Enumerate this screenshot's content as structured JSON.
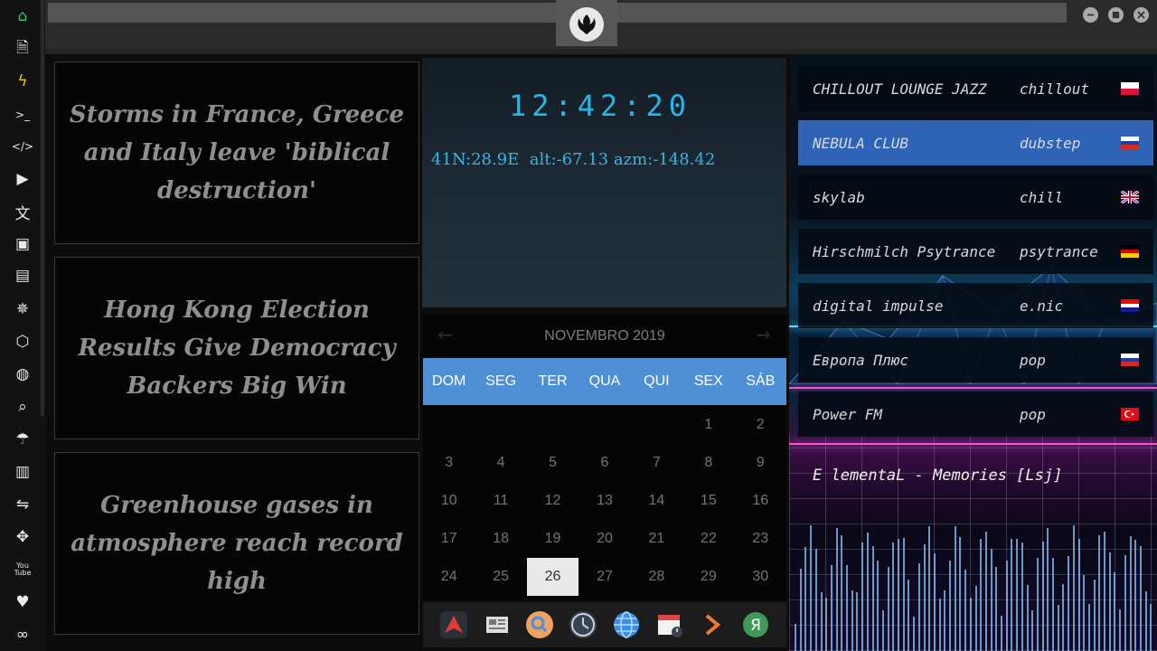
{
  "sidebar": {
    "items": [
      {
        "icon": "home-icon",
        "glyph": "⌂"
      },
      {
        "icon": "document-icon",
        "glyph": "🗎"
      },
      {
        "icon": "lightning-icon",
        "glyph": "ϟ"
      },
      {
        "icon": "terminal-icon",
        "glyph": ">_"
      },
      {
        "icon": "code-icon",
        "glyph": "</>"
      },
      {
        "icon": "play-icon",
        "glyph": "▶"
      },
      {
        "icon": "translate-icon",
        "glyph": "文"
      },
      {
        "icon": "image-icon",
        "glyph": "▣"
      },
      {
        "icon": "newspaper-icon",
        "glyph": "▤"
      },
      {
        "icon": "aperture-icon",
        "glyph": "✵"
      },
      {
        "icon": "hexagon-icon",
        "glyph": "⬡"
      },
      {
        "icon": "globe-icon",
        "glyph": "◍"
      },
      {
        "icon": "search-icon",
        "glyph": "⌕"
      },
      {
        "icon": "umbrella-icon",
        "glyph": "☂"
      },
      {
        "icon": "contacts-icon",
        "glyph": "▥"
      },
      {
        "icon": "swap-icon",
        "glyph": "⇋"
      },
      {
        "icon": "expand-icon",
        "glyph": "✥"
      },
      {
        "icon": "youtube-icon",
        "glyph": "You\nTube"
      },
      {
        "icon": "heart-icon",
        "glyph": "♥"
      },
      {
        "icon": "link-icon",
        "glyph": "∞"
      }
    ],
    "home_color": "#2ecc71",
    "lightning_color": "#f1c40f"
  },
  "news": {
    "headlines": [
      "Storms in France, Greece and Italy leave 'biblical destruction'",
      "Hong Kong Election Results Give Democracy Backers Big Win",
      "Greenhouse gases in atmosphere reach record high"
    ]
  },
  "clock": {
    "time": "12:42:20",
    "coords": "41N:28.9E  alt:-67.13 azm:-148.42",
    "color": "#27b7e6"
  },
  "calendar": {
    "title": "NOVEMBRO 2019",
    "prev": "←",
    "next": "→",
    "weekdays": [
      "DOM",
      "SEG",
      "TER",
      "QUA",
      "QUI",
      "SEX",
      "SÁB"
    ],
    "weeks": [
      [
        "",
        "",
        "",
        "",
        "",
        "1",
        "2"
      ],
      [
        "3",
        "4",
        "5",
        "6",
        "7",
        "8",
        "9"
      ],
      [
        "10",
        "11",
        "12",
        "13",
        "14",
        "15",
        "16"
      ],
      [
        "17",
        "18",
        "19",
        "20",
        "21",
        "22",
        "23"
      ],
      [
        "24",
        "25",
        "26",
        "27",
        "28",
        "29",
        "30"
      ]
    ],
    "today": "26",
    "header_color": "#4f8fd6"
  },
  "dock": {
    "apps": [
      {
        "icon": "arch-icon"
      },
      {
        "icon": "news-reader-icon"
      },
      {
        "icon": "search-app-icon"
      },
      {
        "icon": "clock-app-icon"
      },
      {
        "icon": "browser-globe-icon"
      },
      {
        "icon": "calendar-app-icon"
      },
      {
        "icon": "arrow-app-icon"
      },
      {
        "icon": "yandex-icon"
      }
    ]
  },
  "radio": {
    "stations": [
      {
        "name": "CHILLOUT LOUNGE JAZZ",
        "genre": "chillout",
        "flag": "poland-flag",
        "active": false
      },
      {
        "name": "NEBULA CLUB",
        "genre": "dubstep",
        "flag": "russia-flag",
        "active": true
      },
      {
        "name": "skylab",
        "genre": "chill",
        "flag": "uk-flag",
        "active": false
      },
      {
        "name": "Hirschmilch Psytrance",
        "genre": "psytrance",
        "flag": "germany-flag",
        "active": false
      },
      {
        "name": "digital impulse",
        "genre": "e.nic",
        "flag": "croatia-flag",
        "active": false
      },
      {
        "name": "Европа Плюс",
        "genre": "pop",
        "flag": "russia-flag",
        "active": false
      },
      {
        "name": "Power FM",
        "genre": "pop",
        "flag": "turkey-flag",
        "active": false
      }
    ],
    "now_playing": "E lementaL - Memories [Lsj]",
    "active_color": "#2f63b5"
  }
}
